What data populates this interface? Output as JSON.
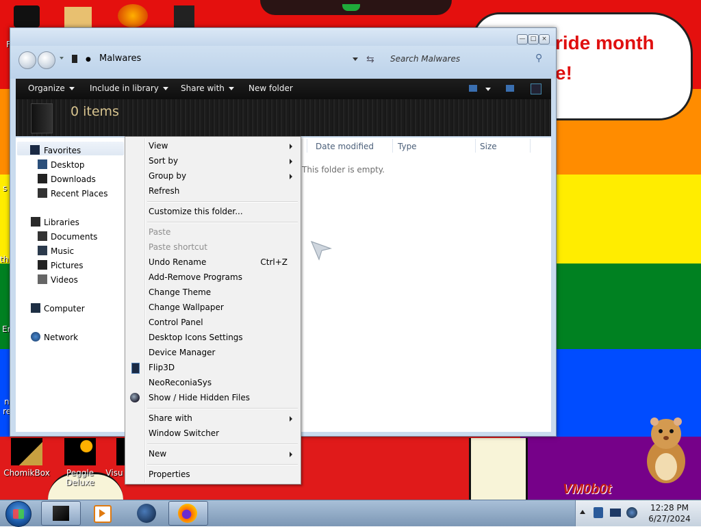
{
  "desktop": {
    "bubble_line1": "ride month",
    "bubble_line2": "e!",
    "icons": [
      {
        "label": "ChomikBox"
      },
      {
        "label": "Peggle Deluxe"
      },
      {
        "label": "Visu"
      }
    ],
    "left_edge_fragments": [
      "F",
      "s",
      "th",
      "Er",
      "n",
      "re"
    ],
    "watermark": "VM0b0t"
  },
  "window": {
    "location": "Malwares",
    "search_placeholder": "Search Malwares",
    "toolbar": {
      "organize": "Organize",
      "include_in_library": "Include in library",
      "share_with": "Share with",
      "new_folder": "New folder"
    },
    "item_count": "0 items",
    "nav": {
      "favorites": "Favorites",
      "desktop": "Desktop",
      "downloads": "Downloads",
      "recent_places": "Recent Places",
      "libraries": "Libraries",
      "documents": "Documents",
      "music": "Music",
      "pictures": "Pictures",
      "videos": "Videos",
      "computer": "Computer",
      "network": "Network"
    },
    "columns": {
      "date_modified": "Date modified",
      "type": "Type",
      "size": "Size"
    },
    "empty_message": "This folder is empty."
  },
  "context_menu": {
    "items": [
      {
        "label": "View",
        "submenu": true
      },
      {
        "label": "Sort by",
        "submenu": true
      },
      {
        "label": "Group by",
        "submenu": true
      },
      {
        "label": "Refresh"
      },
      {
        "label": "Customize this folder..."
      },
      {
        "label": "Paste",
        "disabled": true
      },
      {
        "label": "Paste shortcut",
        "disabled": true
      },
      {
        "label": "Undo Rename",
        "shortcut": "Ctrl+Z"
      },
      {
        "label": "Add-Remove Programs"
      },
      {
        "label": "Change Theme"
      },
      {
        "label": "Change Wallpaper"
      },
      {
        "label": "Control Panel"
      },
      {
        "label": "Desktop Icons Settings"
      },
      {
        "label": "Device Manager"
      },
      {
        "label": "Flip3D",
        "icon": "flip3d-icon"
      },
      {
        "label": "NeoReconiaSys"
      },
      {
        "label": "Show / Hide Hidden Files",
        "icon": "hidden-files-icon"
      },
      {
        "label": "Share with",
        "submenu": true
      },
      {
        "label": "Window Switcher"
      },
      {
        "label": "New",
        "submenu": true
      },
      {
        "label": "Properties"
      }
    ]
  },
  "taskbar": {
    "clock_time": "12:28 PM",
    "clock_date": "6/27/2024"
  },
  "colors": {
    "rainbow_red": "#e4100e",
    "rainbow_orange": "#ff8c00",
    "rainbow_yellow": "#ffed00",
    "rainbow_green": "#008121",
    "rainbow_blue": "#004cff",
    "rainbow_purple": "#760189"
  }
}
